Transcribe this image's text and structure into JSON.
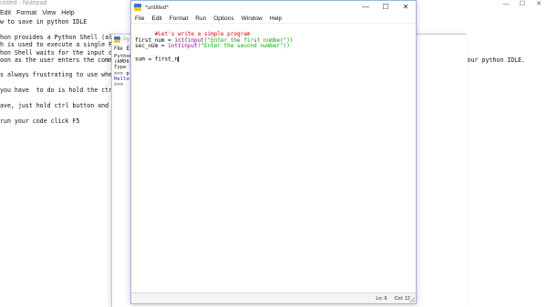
{
  "notepad": {
    "title": "ntitled - Notepad",
    "window_controls": [
      "—",
      "☐",
      "✕"
    ],
    "menu": [
      "Edit",
      "Format",
      "View",
      "Help"
    ],
    "menu_prefix": "",
    "lines": [
      "w to save in python IDLE",
      "hon provides a Python Shell (also",
      "h is used to execute a single Pyt",
      "hon Shell waits for the input comm",
      "oon as the user enters the comman",
      "s always frustrating to use when",
      "you have  to do is hold the ctrl",
      "ave, just hold ctrl button and s",
      "run your code click F5"
    ],
    "right_fragment": "en you open your python IDLE."
  },
  "shell": {
    "title": "Py",
    "menu": [
      "File",
      "Ed"
    ],
    "lines": [
      {
        "text": "Python",
        "color": "dark"
      },
      {
        "text": "(AMD6",
        "color": "dark"
      },
      {
        "text": "Type \"",
        "color": "dark"
      },
      {
        "text": ">>> p",
        "color": "dark"
      },
      {
        "text": "Hello",
        "color": "blue"
      },
      {
        "text": ">>>",
        "color": "dark"
      }
    ]
  },
  "editor": {
    "title": "*untitled*",
    "window_controls": [
      "—",
      "☐",
      "✕"
    ],
    "menu": [
      "File",
      "Edit",
      "Format",
      "Run",
      "Options",
      "Window",
      "Help"
    ],
    "code": {
      "comment": "#Let's write a simple program",
      "line2_var": "first_num = ",
      "line2_int": "int",
      "line2_paren": "(",
      "line2_input": "input",
      "line2_str": "(\"Enter the first number\"))",
      "line3_var": "sec_num = ",
      "line3_int": "int",
      "line3_paren": "(",
      "line3_input": "input",
      "line3_str": "(\"Enter the second number\"))",
      "line5": "sum = first_n"
    },
    "status": {
      "line": "Ln: 6",
      "col": "Col: 12"
    }
  }
}
